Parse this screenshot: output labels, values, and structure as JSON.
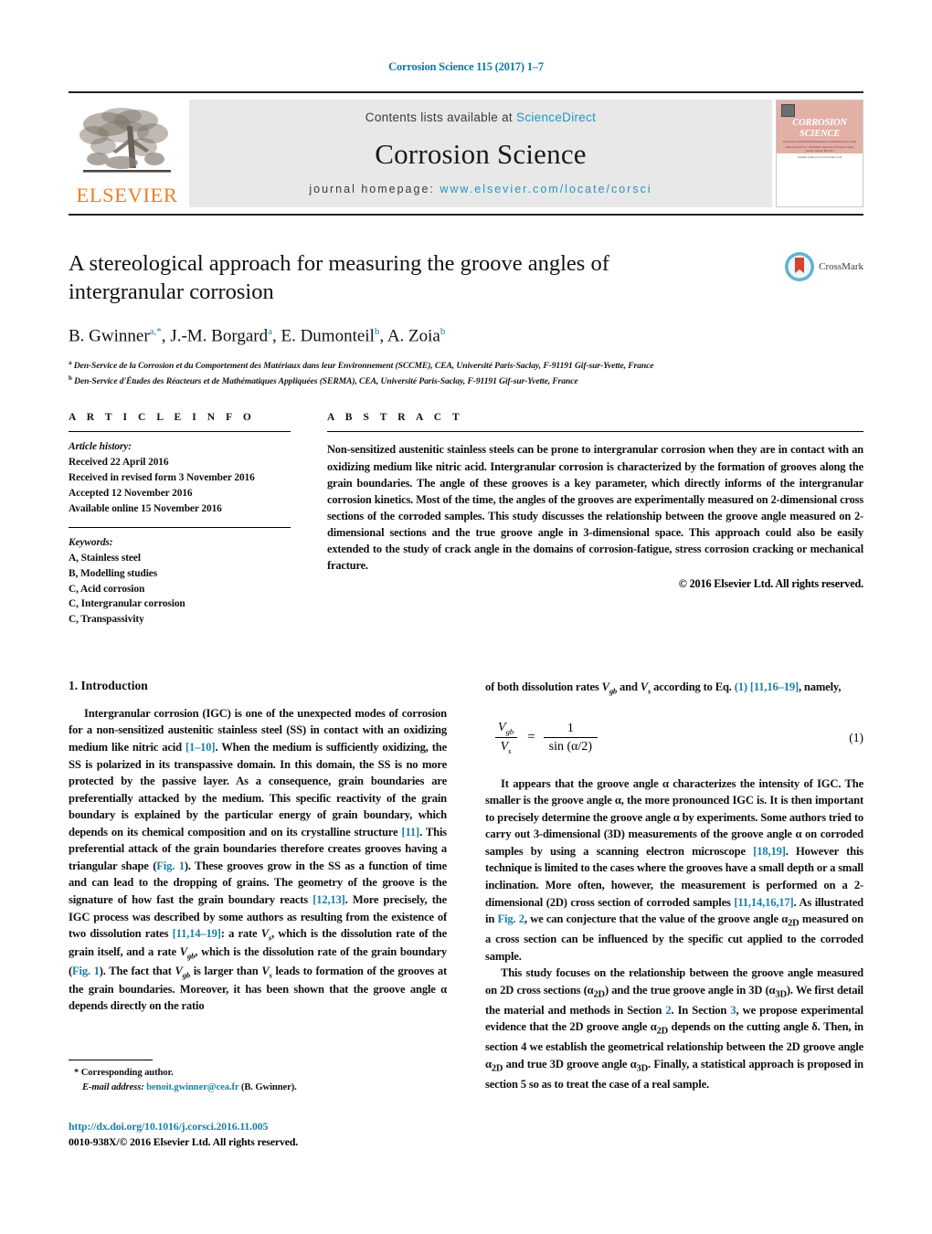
{
  "running_head": "Corrosion Science 115 (2017) 1–7",
  "banner": {
    "publisher_name": "ELSEVIER",
    "contents_prefix": "Contents lists available at",
    "contents_link": "ScienceDirect",
    "journal_title": "Corrosion Science",
    "homepage_prefix": "journal homepage:",
    "homepage_url": "www.elsevier.com/locate/corsci",
    "cover": {
      "line1": "CORROSION",
      "line2": "SCIENCE",
      "blurb": "The Journal on Environmental Degradation of Materials and its Control",
      "editors": "Editors-in-Chief: R.C. NEWMAN, University of Toronto, Canada, Toronto, Ontario, M5S 3E5",
      "footer": "Available online at www.sciencedirect.com"
    }
  },
  "title": "A stereological approach for measuring the groove angles of intergranular corrosion",
  "crossmark_label": "CrossMark",
  "authors_html": "B. Gwinner<sup>a,*</sup>, J.-M. Borgard<sup>a</sup>, E. Dumonteil<sup>b</sup>, A. Zoia<sup>b</sup>",
  "affiliations": [
    {
      "marker": "a",
      "text": "Den-Service de la Corrosion et du Comportement des Matériaux dans leur Environnement (SCCME), CEA, Université Paris-Saclay, F-91191 Gif-sur-Yvette, France"
    },
    {
      "marker": "b",
      "text": "Den-Service d'Études des Réacteurs et de Mathématiques Appliquées (SERMA), CEA, Université Paris-Saclay, F-91191 Gif-sur-Yvette, France"
    }
  ],
  "article_info": {
    "heading": "A R T I C L E    I N F O",
    "history_label": "Article history:",
    "history": [
      "Received 22 April 2016",
      "Received in revised form 3 November 2016",
      "Accepted 12 November 2016",
      "Available online 15 November 2016"
    ],
    "keywords_label": "Keywords:",
    "keywords": [
      "A, Stainless steel",
      "B, Modelling studies",
      "C, Acid corrosion",
      "C, Intergranular corrosion",
      "C, Transpassivity"
    ]
  },
  "abstract": {
    "heading": "A B S T R A C T",
    "text": "Non-sensitized austenitic stainless steels can be prone to intergranular corrosion when they are in contact with an oxidizing medium like nitric acid. Intergranular corrosion is characterized by the formation of grooves along the grain boundaries. The angle of these grooves is a key parameter, which directly informs of the intergranular corrosion kinetics. Most of the time, the angles of the grooves are experimentally measured on 2-dimensional cross sections of the corroded samples. This study discusses the relationship between the groove angle measured on 2-dimensional sections and the true groove angle in 3-dimensional space. This approach could also be easily extended to the study of crack angle in the domains of corrosion-fatigue, stress corrosion cracking or mechanical fracture.",
    "copyright": "© 2016 Elsevier Ltd. All rights reserved."
  },
  "body": {
    "section1_title": "1.  Introduction",
    "left_para1_html": "Intergranular corrosion (IGC) is one of the unexpected modes of corrosion for a non-sensitized austenitic stainless steel (SS) in contact with an oxidizing medium like nitric acid <span class=\"lnk\">[1–10]</span>. When the medium is sufficiently oxidizing, the SS is polarized in its transpassive domain. In this domain, the SS is no more protected by the passive layer. As a consequence, grain boundaries are preferentially attacked by the medium. This specific reactivity of the grain boundary is explained by the particular energy of grain boundary, which depends on its chemical composition and on its crystalline structure <span class=\"lnk\">[11]</span>. This preferential attack of the grain boundaries therefore creates grooves having a triangular shape (<span class=\"lnk\">Fig. 1</span>). These grooves grow in the SS as a function of time and can lead to the dropping of grains. The geometry of the groove is the signature of how fast the grain boundary reacts <span class=\"lnk\">[12,13]</span>. More precisely, the IGC process was described by some authors as resulting from the existence of two dissolution rates <span class=\"lnk\">[11,14–19]</span>: a rate <span class=\"var\">V<sub>s</sub></span>, which is the dissolution rate of the grain itself, and a rate <span class=\"var\">V<sub>gb</sub></span>, which is the dissolution rate of the grain boundary (<span class=\"lnk\">Fig. 1</span>). The fact that <span class=\"var\">V<sub>gb</sub></span> is larger than <span class=\"var\">V<sub>s</sub></span> leads to formation of the grooves at the grain boundaries. Moreover, it has been shown that the groove angle α depends directly on the ratio",
    "right_para1_html": "of both dissolution rates <span class=\"var\">V<sub>gb</sub></span> and <span class=\"var\">V<sub>s</sub></span> according to Eq. <span class=\"lnk\">(1)</span> <span class=\"lnk\">[11,16–19]</span>, namely,",
    "equation": {
      "num_left": "V",
      "num_left_sub": "gb",
      "den_left": "V",
      "den_left_sub": "s",
      "equals": "=",
      "num_right": "1",
      "den_right": "sin (α/2)",
      "number": "(1)"
    },
    "right_para2_html": "It appears that the groove angle α characterizes the intensity of IGC. The smaller is the groove angle α, the more pronounced IGC is. It is then important to precisely determine the groove angle α by experiments. Some authors tried to carry out 3-dimensional (3D) measurements of the groove angle α on corroded samples by using a scanning electron microscope <span class=\"lnk\">[18,19]</span>. However this technique is limited to the cases where the grooves have a small depth or a small inclination. More often, however, the measurement is performed on a 2-dimensional (2D) cross section of corroded samples <span class=\"lnk\">[11,14,16,17]</span>. As illustrated in <span class=\"lnk\">Fig. 2</span>, we can conjecture that the value of the groove angle α<sub>2D</sub> measured on a cross section can be influenced by the specific cut applied to the corroded sample.",
    "right_para3_html": "This study focuses on the relationship between the groove angle measured on 2D cross sections (α<sub>2D</sub>) and the true groove angle in 3D (α<sub>3D</sub>). We first detail the material and methods in Section <span class=\"lnk\">2</span>. In Section <span class=\"lnk\">3</span>, we propose experimental evidence that the 2D groove angle α<sub>2D</sub> depends on the cutting angle δ. Then, in section 4 we establish the geometrical relationship between the 2D groove angle α<sub>2D</sub> and true 3D groove angle α<sub>3D</sub>. Finally, a statistical approach is proposed in section 5 so as to treat the case of a real sample."
  },
  "footnote": {
    "corresponding": "*  Corresponding author.",
    "email_label": "E-mail address:",
    "email": "benoit.gwinner@cea.fr",
    "email_suffix": "(B. Gwinner)."
  },
  "doi": {
    "url": "http://dx.doi.org/10.1016/j.corsci.2016.11.005",
    "issn_line": "0010-938X/© 2016 Elsevier Ltd. All rights reserved."
  },
  "colors": {
    "link": "#1a7fa8",
    "running_head": "#0b7ba8",
    "elsevier_orange": "#f07d22",
    "banner_bg": "#e8e8e8",
    "cover_salmon": "#e3b0a6",
    "crossmark_red": "#d8412a",
    "crossmark_blue": "#5fb3d4"
  }
}
